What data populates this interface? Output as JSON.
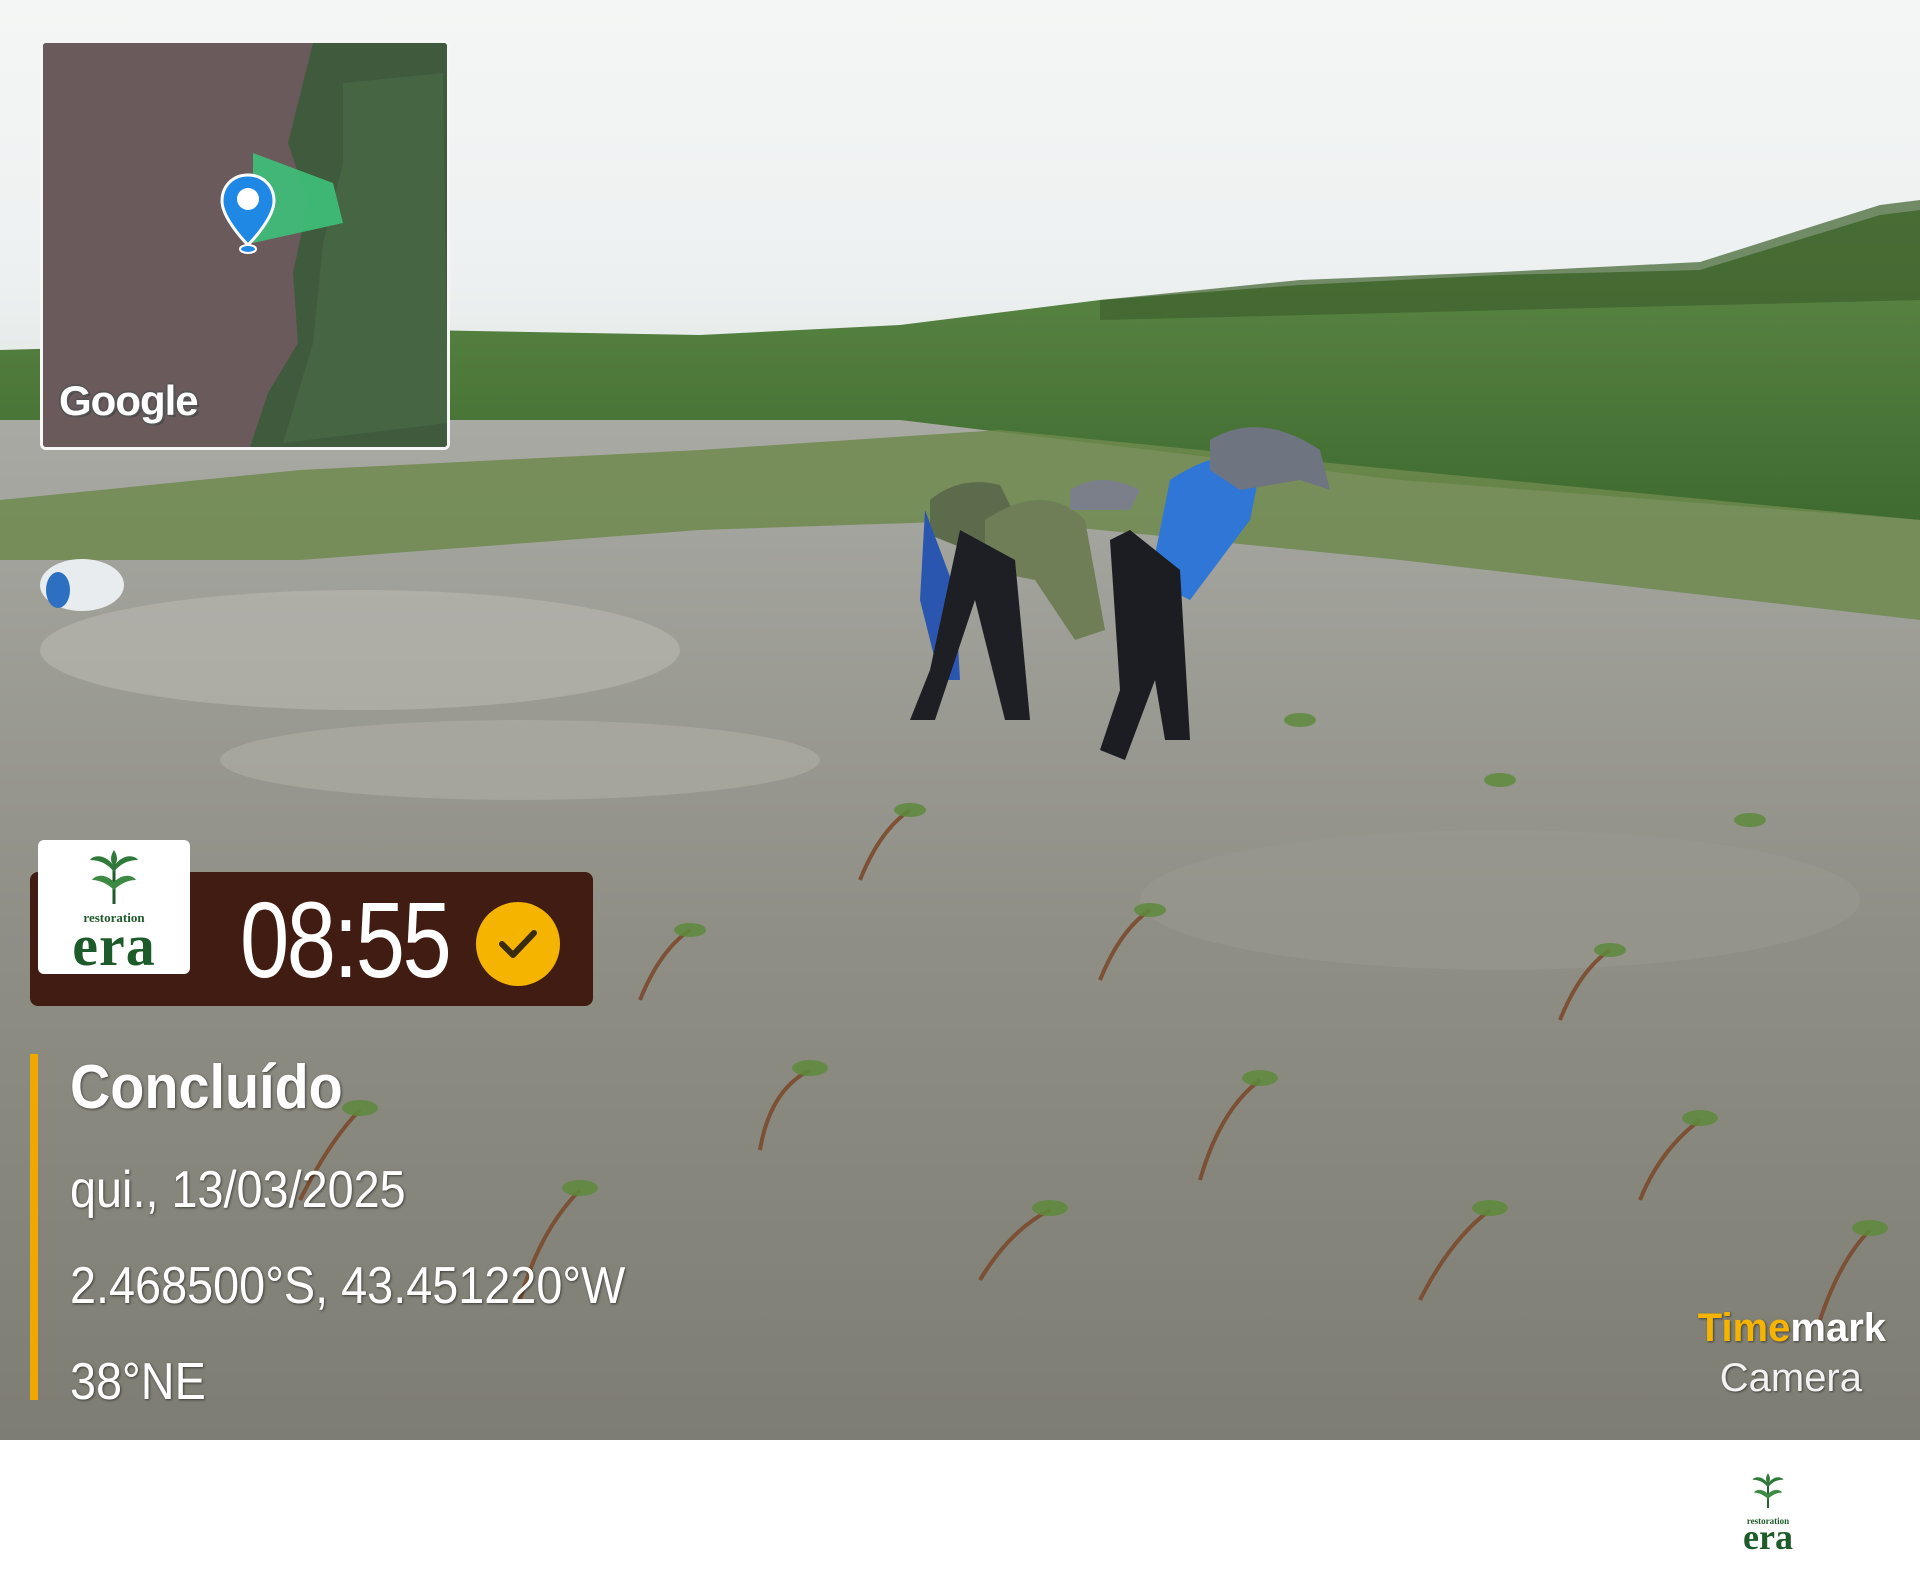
{
  "map": {
    "provider_label": "Google"
  },
  "timecard": {
    "logo_small": "restoration",
    "logo_big": "era",
    "time": "08:55",
    "check_icon": "checkmark-icon",
    "accent_color": "#f4b400",
    "card_color": "#401c12"
  },
  "info": {
    "status": "Concluído",
    "date": "qui., 13/03/2025",
    "coordinates": "2.468500°S, 43.451220°W",
    "heading": "38°NE",
    "bar_color": "#f0a800"
  },
  "watermark": {
    "brand_accent": "Time",
    "brand_rest": "mark",
    "subtitle": "Camera"
  },
  "footer": {
    "logo_small": "restoration",
    "logo_big": "era"
  }
}
